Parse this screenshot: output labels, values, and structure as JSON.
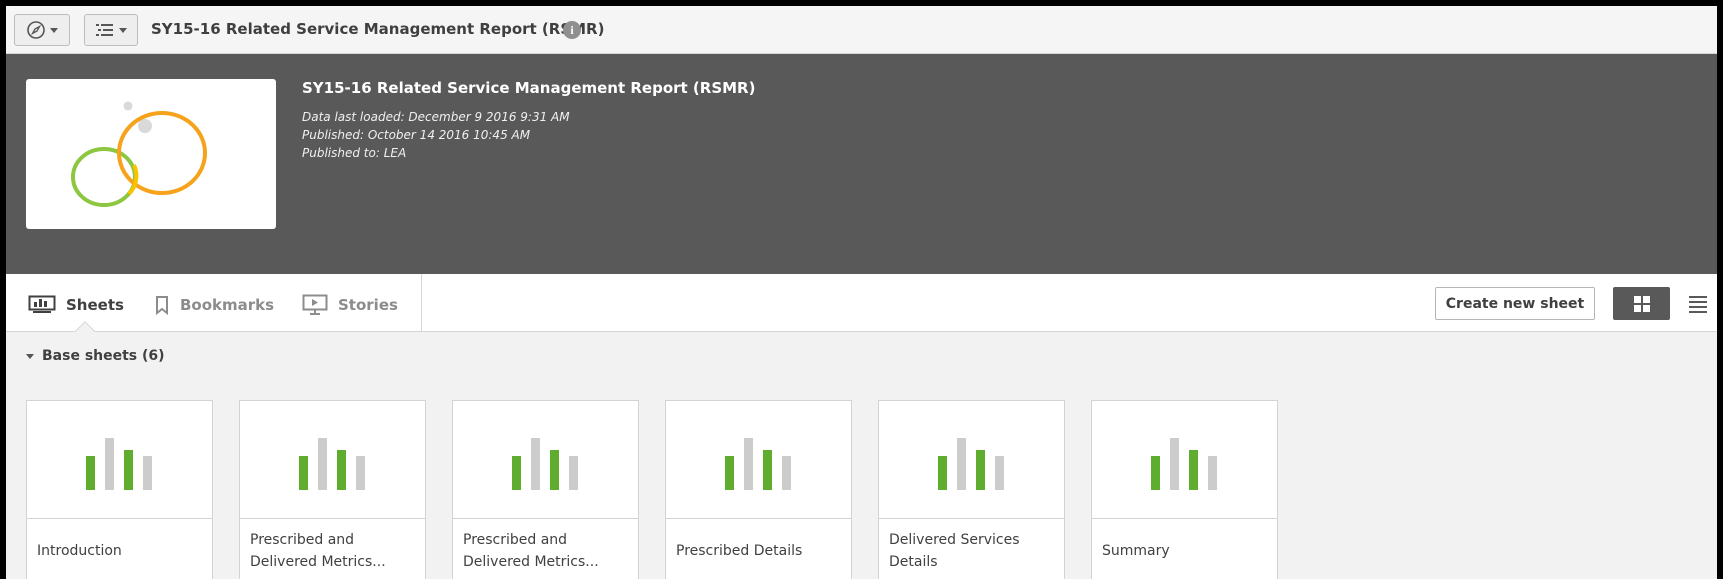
{
  "toolbar": {
    "app_title": "SY15-16 Related Service Management Report (RSMR)",
    "info_icon": "i"
  },
  "header": {
    "title": "SY15-16 Related Service Management Report (RSMR)",
    "data_last_loaded": "Data last loaded: December 9 2016 9:31 AM",
    "published": "Published: October 14 2016 10:45 AM",
    "published_to": "Published to: LEA"
  },
  "tabs": {
    "sheets": "Sheets",
    "bookmarks": "Bookmarks",
    "stories": "Stories"
  },
  "actions": {
    "create_new_sheet": "Create new sheet"
  },
  "section": {
    "title": "Base sheets (6)"
  },
  "sheets": [
    {
      "label": "Introduction"
    },
    {
      "label": "Prescribed and Delivered Metrics..."
    },
    {
      "label": "Prescribed and Delivered Metrics..."
    },
    {
      "label": "Prescribed Details"
    },
    {
      "label": "Delivered Services Details"
    },
    {
      "label": "Summary"
    }
  ],
  "colors": {
    "header_bg": "#595959",
    "bar_green": "#5fad2f",
    "bar_gray": "#cccccc",
    "logo_green": "#8dc63f",
    "logo_orange": "#f7a21b"
  },
  "icons": {
    "nav": "compass-icon",
    "list": "list-icon",
    "info": "info-icon",
    "sheets": "sheets-icon",
    "bookmarks": "bookmark-icon",
    "stories": "stories-icon",
    "grid_view": "grid-view-icon",
    "list_view": "list-view-icon"
  }
}
